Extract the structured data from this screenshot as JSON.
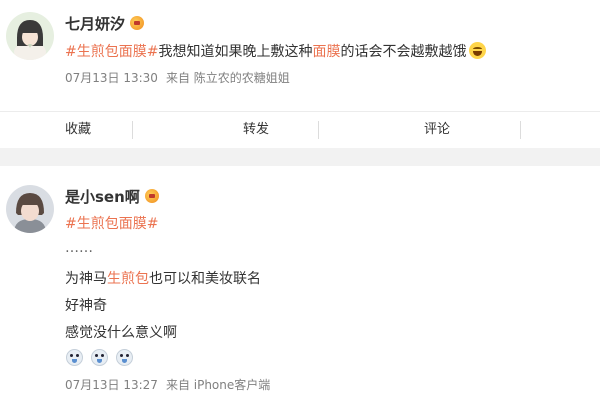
{
  "post1": {
    "username": "七月妍汐",
    "text": {
      "tag_text": "#生煎包面膜#",
      "body_text": "我想知道如果晚上敷这种",
      "keyword": "面膜",
      "tail_text": "的话会不会越敷越饿"
    },
    "emoji_icon": "grinning-sweat-emoji",
    "date": "07月13日 13:30",
    "source": "来自 陈立农的农糖姐姐"
  },
  "actions": {
    "favorite": "收藏",
    "repost": "转发",
    "comment": "评论"
  },
  "post2": {
    "username": "是小sen啊",
    "tag_text": "#生煎包面膜#",
    "ellipsis": "……",
    "line1_pre": "为神马",
    "line1_keyword": "生煎包",
    "line1_post": "也可以和美妆联名",
    "line2": "好神奇",
    "line3": "感觉没什么意义啊",
    "stickers": [
      "crying-face-sticker",
      "crying-face-sticker",
      "crying-face-sticker"
    ],
    "date": "07月13日 13:27",
    "source": "来自 iPhone客户端"
  },
  "colors": {
    "highlight": "#eb7350",
    "background": "#f2f2f2",
    "meta_gray": "#808080"
  }
}
